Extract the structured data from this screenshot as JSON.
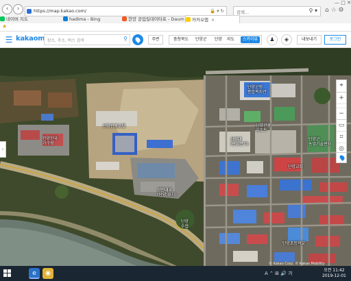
{
  "browser": {
    "url": "https://map.kakao.com/",
    "search_placeholder": "검색...",
    "tabs": [
      {
        "label": "네이버 지도",
        "active": false,
        "color": "#03c75a"
      },
      {
        "label": "hadima - Bing",
        "active": false,
        "color": "#0f7fd6"
      },
      {
        "label": "한양 공업킬데이타포 - Daum ...",
        "active": false,
        "color": "#f15a24"
      },
      {
        "label": "카카오맵",
        "active": true,
        "color": "#ffcd00"
      }
    ]
  },
  "kakaomap": {
    "logo": "kakaomap",
    "search_placeholder": "장소, 주소, 버스 검색",
    "nearby_label": "주변",
    "breadcrumb": [
      "충청북도",
      "단양군",
      "단양",
      "지도"
    ],
    "skyview_label": "스카이뷰",
    "share_label": "내보내기",
    "login_label": "로그인"
  },
  "map": {
    "labels": [
      {
        "id": "label-dong-office",
        "text": "단양군청\n종합복지관"
      },
      {
        "id": "label-hotel",
        "text": "단양관광호텔"
      },
      {
        "id": "label-resort",
        "text": "단양관광\n리조트"
      },
      {
        "id": "label-dept",
        "text": "단양군\n농업기술센터"
      },
      {
        "id": "label-school",
        "text": "삼성대\n(단양분교)"
      },
      {
        "id": "label-market",
        "text": "상진대교\n(단양 위치)"
      },
      {
        "id": "label-church",
        "text": "단양교회"
      },
      {
        "id": "label-bank",
        "text": "단양\n수협"
      },
      {
        "id": "label-station",
        "text": "한양한국\n가구점"
      },
      {
        "id": "label-park",
        "text": "단양초등학교"
      }
    ],
    "copyright": "© Kakao Corp. © Kakao Mobility"
  },
  "taskbar": {
    "tray_text": "A  ⌃  ⊞  🔊",
    "ime": "가",
    "time_ampm": "오전 11:42",
    "date": "2019-12-01"
  },
  "colors": {
    "kakao_blue": "#1e88e5",
    "taskbar": "#1b2633"
  }
}
